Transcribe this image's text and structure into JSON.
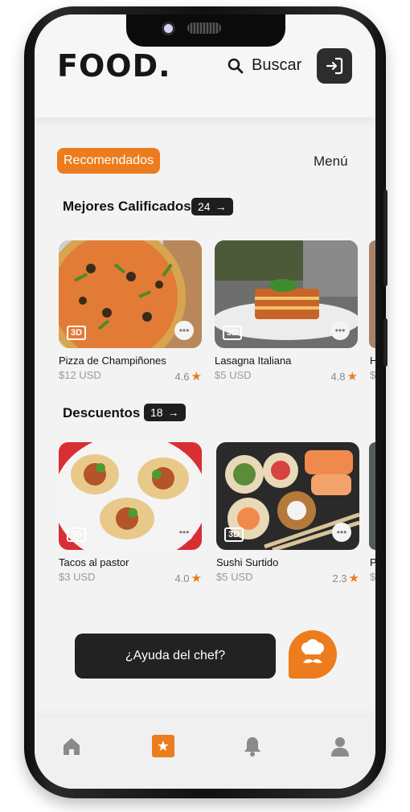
{
  "app": {
    "logo": "FOOD.",
    "search_label": "Buscar"
  },
  "tabs": {
    "recommended": "Recomendados",
    "menu": "Menú"
  },
  "sections": {
    "top_rated": {
      "title": "Mejores Calificados",
      "count": "24"
    },
    "discounts": {
      "title": "Descuentos",
      "count": "18"
    }
  },
  "top_rated_items": [
    {
      "name": "Pizza de Champiñones",
      "price": "$12 USD",
      "rating": "4.6",
      "badge": "3D"
    },
    {
      "name": "Lasagna Italiana",
      "price": "$5 USD",
      "rating": "4.8",
      "badge": "3D"
    }
  ],
  "discount_items": [
    {
      "name": "Tacos al pastor",
      "price": "$3 USD",
      "rating": "4.0",
      "badge": "3D"
    },
    {
      "name": "Sushi Surtido",
      "price": "$5 USD",
      "rating": "2.3",
      "badge": "3D"
    }
  ],
  "peek": {
    "top_rated_initial": "H",
    "discounts_initial": "P",
    "price_initial": "$"
  },
  "chef": {
    "help_label": "¿Ayuda del chef?"
  },
  "colors": {
    "accent": "#ec7c1d",
    "dark": "#222222",
    "background": "#f3f3f3"
  },
  "icons": [
    "search-icon",
    "login-icon",
    "arrow-right-icon",
    "star-icon",
    "more-icon",
    "chef-icon",
    "home-icon",
    "favorites-icon",
    "bell-icon",
    "user-icon"
  ]
}
